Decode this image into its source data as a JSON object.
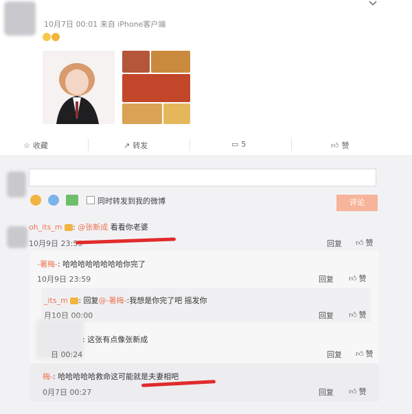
{
  "post": {
    "time_source": "10月7日 00:01 来自 iPhone客户端",
    "emoji_count": 2
  },
  "actions": {
    "favorite": "收藏",
    "repost": "转发",
    "comment_count": "5",
    "like": "赞"
  },
  "composer": {
    "placeholder": "",
    "also_repost": "同时转发到我的微博",
    "submit": "评论"
  },
  "main_comment": {
    "user": "oh_its_m",
    "mention": "@张新成",
    "text": "看看你老婆",
    "time": "10月9日 23:59",
    "reply": "回复",
    "like": "赞"
  },
  "replies": [
    {
      "user": "-著梅-",
      "text": "哈哈哈哈哈哈哈哈你完了",
      "time": "10月9日 23:59",
      "reply": "回复",
      "like": "赞"
    },
    {
      "user": "_its_m",
      "prefix": "回复",
      "mention": "@-著梅-",
      "text": ":我想是你完了吧 摇发你",
      "time": "月10日 00:00",
      "reply": "回复",
      "like": "赞"
    },
    {
      "user": "",
      "text": "这张有点像张新成",
      "time": "日 00:24",
      "reply": "回复",
      "like": "赞"
    },
    {
      "user": "梅-",
      "text": "哈哈哈哈哈救命这可能就是夫妻相吧",
      "time": "0月7日 00:27",
      "reply": "回复",
      "like": "赞"
    }
  ],
  "colors": {
    "accent": "#eb7350",
    "underline": "#e02b2b",
    "submit_bg": "#f6b49a"
  }
}
